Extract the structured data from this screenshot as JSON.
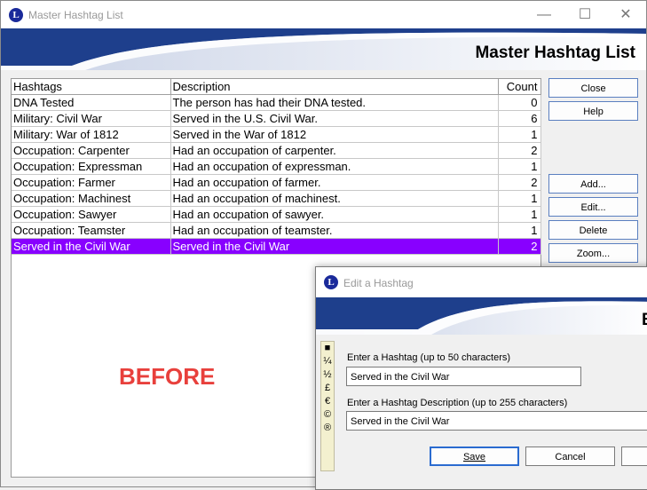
{
  "window": {
    "title": "Master Hashtag List",
    "banner_title": "Master Hashtag List",
    "minimize_icon": "—",
    "maximize_icon": "☐",
    "close_icon": "✕"
  },
  "app_logo": "L",
  "grid": {
    "headers": {
      "hashtags": "Hashtags",
      "description": "Description",
      "count": "Count"
    },
    "rows": [
      {
        "tag": "DNA Tested",
        "desc": "The person has had their DNA tested.",
        "count": "0"
      },
      {
        "tag": "Military: Civil War",
        "desc": "Served in the U.S. Civil War.",
        "count": "6"
      },
      {
        "tag": "Military: War of 1812",
        "desc": "Served in the War of 1812",
        "count": "1"
      },
      {
        "tag": "Occupation: Carpenter",
        "desc": "Had an occupation of carpenter.",
        "count": "2"
      },
      {
        "tag": "Occupation: Expressman",
        "desc": "Had an occupation of expressman.",
        "count": "1"
      },
      {
        "tag": "Occupation: Farmer",
        "desc": "Had an occupation of farmer.",
        "count": "2"
      },
      {
        "tag": "Occupation: Machinest",
        "desc": "Had an occupation of machinest.",
        "count": "1"
      },
      {
        "tag": "Occupation: Sawyer",
        "desc": "Had an occupation of sawyer.",
        "count": "1"
      },
      {
        "tag": "Occupation: Teamster",
        "desc": "Had an occupation of teamster.",
        "count": "1"
      },
      {
        "tag": "Served in the Civil War",
        "desc": "Served in the Civil War",
        "count": "2"
      }
    ]
  },
  "annotation": "BEFORE",
  "buttons": {
    "close": "Close",
    "help": "Help",
    "add": "Add...",
    "edit": "Edit...",
    "delete": "Delete",
    "zoom": "Zoom..."
  },
  "dialog": {
    "title": "Edit a Hashtag",
    "banner_title": "E",
    "hashtag_label": "Enter a Hashtag (up to 50 characters)",
    "hashtag_value": "Served in the Civil War",
    "description_label": "Enter a Hashtag Description (up to 255 characters)",
    "description_value": "Served in the Civil War",
    "save": "Save",
    "cancel": "Cancel",
    "charbar": [
      "■",
      "¼",
      "½",
      "£",
      "€",
      "©",
      "®"
    ]
  },
  "colors": {
    "selection": "#8800ff",
    "banner_blue": "#1e3f8c",
    "annotation": "#e8403c"
  }
}
